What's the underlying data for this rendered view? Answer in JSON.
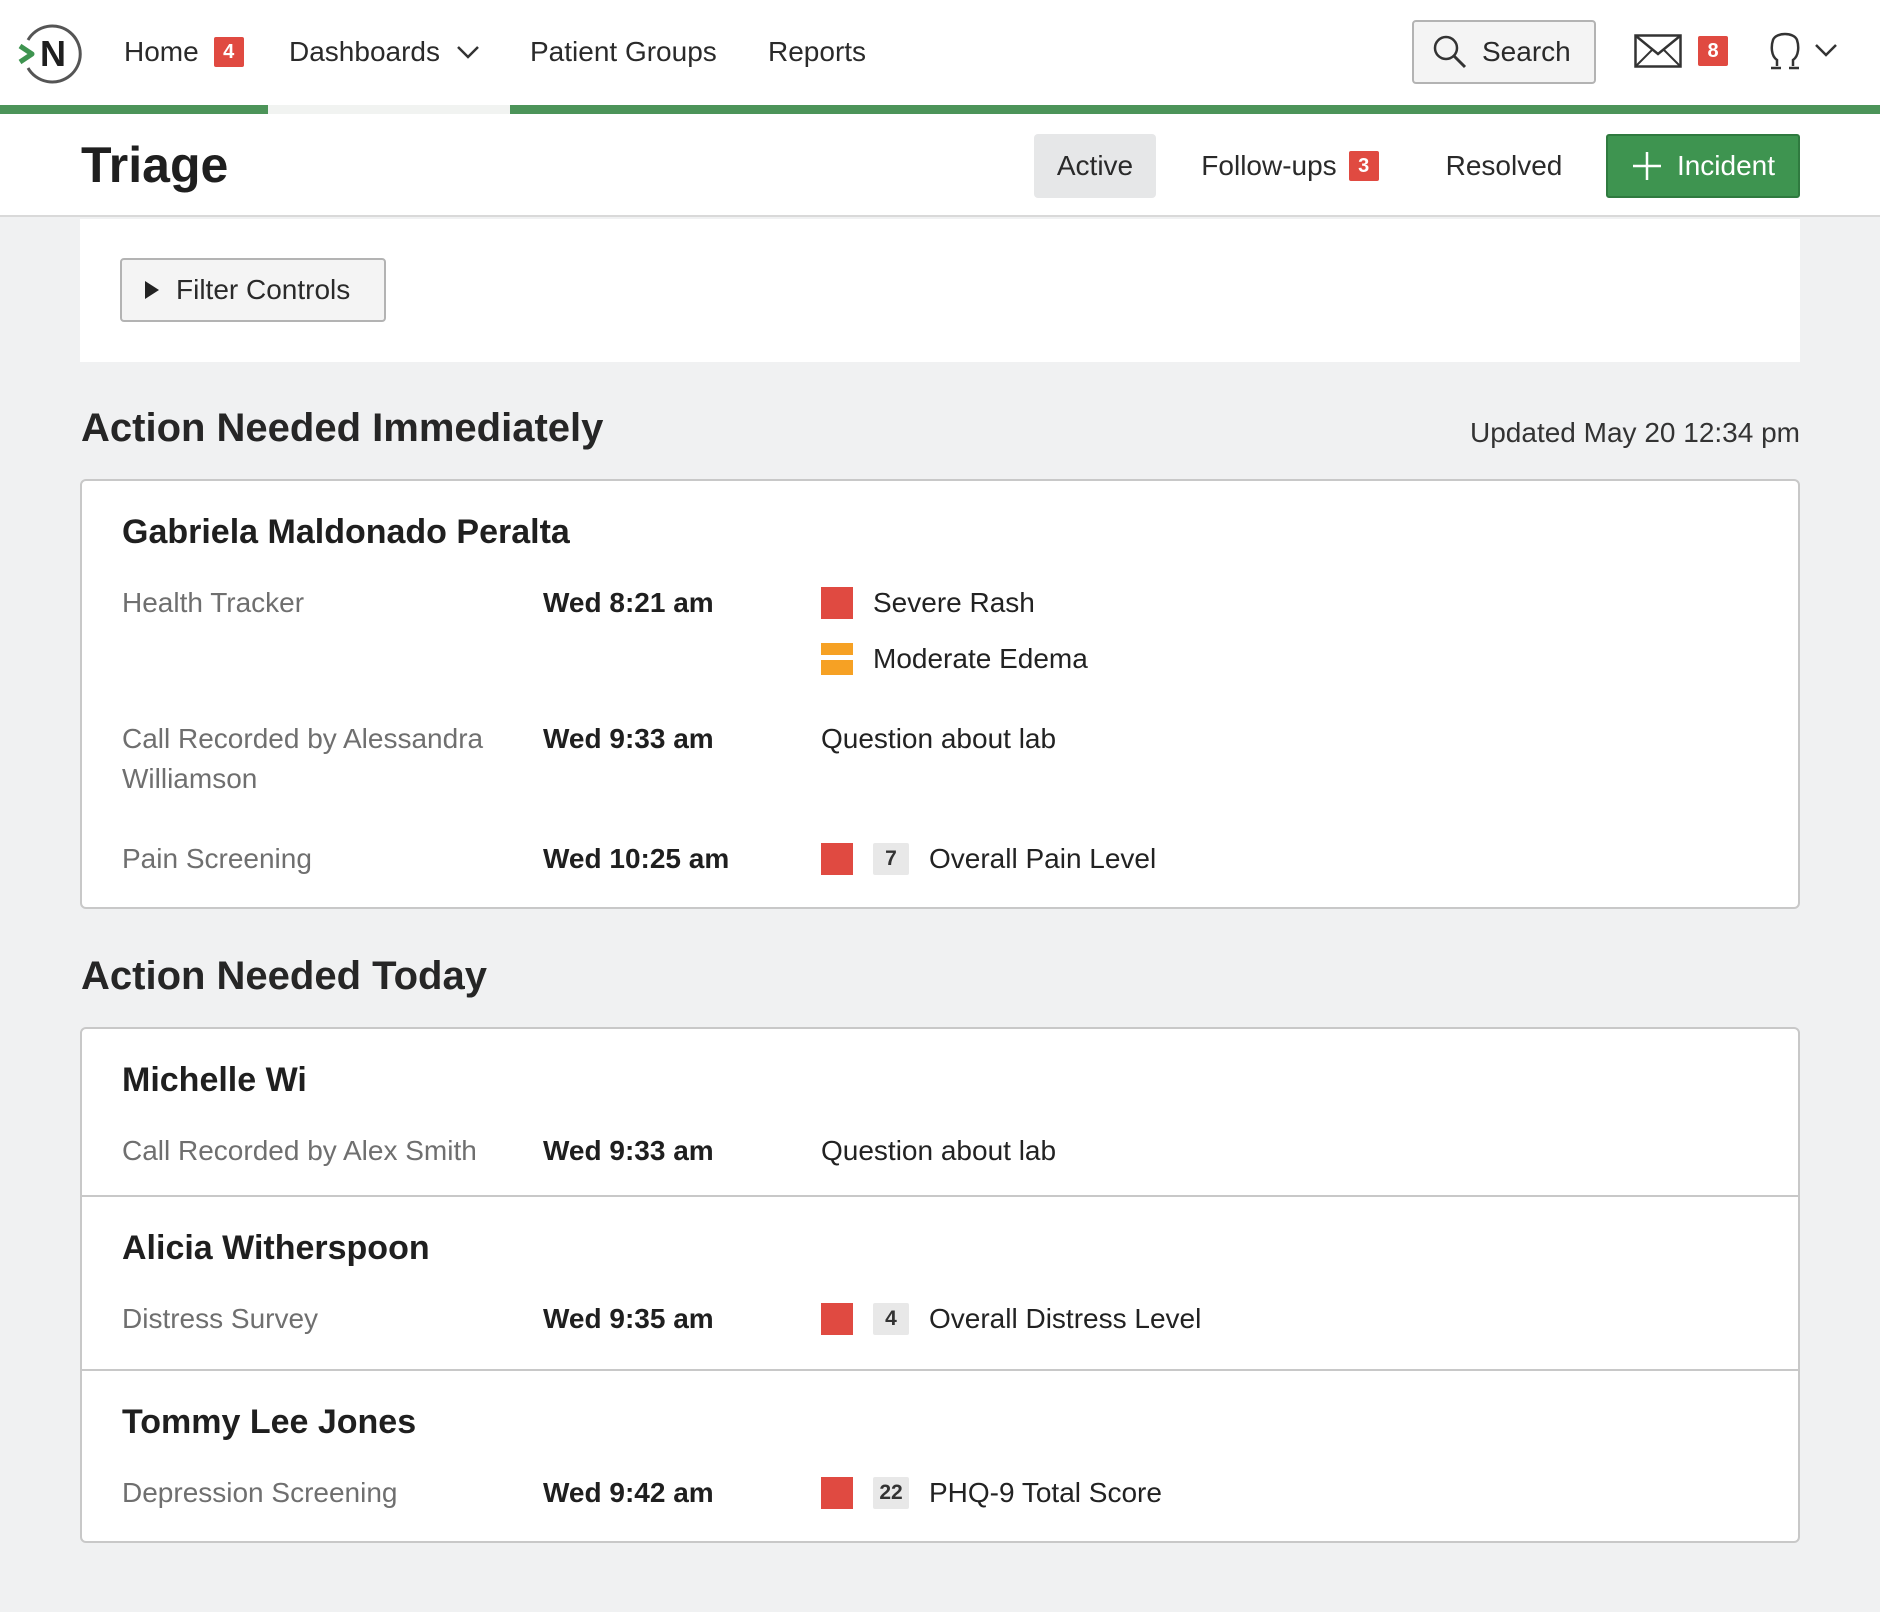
{
  "nav": {
    "logo_letter": "N",
    "items": [
      {
        "label": "Home",
        "badge": "4"
      },
      {
        "label": "Dashboards"
      },
      {
        "label": "Patient Groups"
      },
      {
        "label": "Reports"
      }
    ],
    "search_label": "Search",
    "mail_badge": "8",
    "icons": [
      "logo-icon",
      "chevron-down-icon",
      "search-icon",
      "mail-icon",
      "user-icon"
    ]
  },
  "header": {
    "title": "Triage",
    "tabs": [
      {
        "label": "Active",
        "active": true
      },
      {
        "label": "Follow-ups",
        "badge": "3"
      },
      {
        "label": "Resolved"
      }
    ],
    "incident_label": "Incident"
  },
  "filter": {
    "label": "Filter Controls"
  },
  "immediate": {
    "title": "Action Needed Immediately",
    "updated": "Updated May 20 12:34 pm",
    "patients": [
      {
        "name": "Gabriela Maldonado Peralta",
        "entries": [
          {
            "source": "Health Tracker",
            "time": "Wed 8:21 am",
            "findings": [
              {
                "severity": "high",
                "label": "Severe Rash"
              },
              {
                "severity": "moderate",
                "label": "Moderate Edema"
              }
            ]
          },
          {
            "source": "Call Recorded by Alessandra Williamson",
            "time": "Wed 9:33 am",
            "findings": [
              {
                "label": "Question about lab"
              }
            ]
          },
          {
            "source": "Pain Screening",
            "time": "Wed 10:25 am",
            "findings": [
              {
                "severity": "high",
                "score": "7",
                "label": "Overall Pain Level"
              }
            ]
          }
        ]
      }
    ]
  },
  "today": {
    "title": "Action Needed Today",
    "patients": [
      {
        "name": "Michelle Wi",
        "source": "Call Recorded by Alex Smith",
        "time": "Wed 9:33 am",
        "finding": {
          "label": "Question about lab"
        }
      },
      {
        "name": "Alicia Witherspoon",
        "source": "Distress Survey",
        "time": "Wed 9:35 am",
        "finding": {
          "severity": "high",
          "score": "4",
          "label": "Overall Distress Level"
        }
      },
      {
        "name": "Tommy Lee Jones",
        "source": "Depression Screening",
        "time": "Wed 9:42 am",
        "finding": {
          "severity": "high",
          "score": "22",
          "label": "PHQ-9 Total Score"
        }
      }
    ]
  },
  "colors": {
    "brand_green": "#4c9459",
    "button_green": "#3e9450",
    "alert_red": "#e04a41",
    "warning_orange": "#f6a124"
  }
}
